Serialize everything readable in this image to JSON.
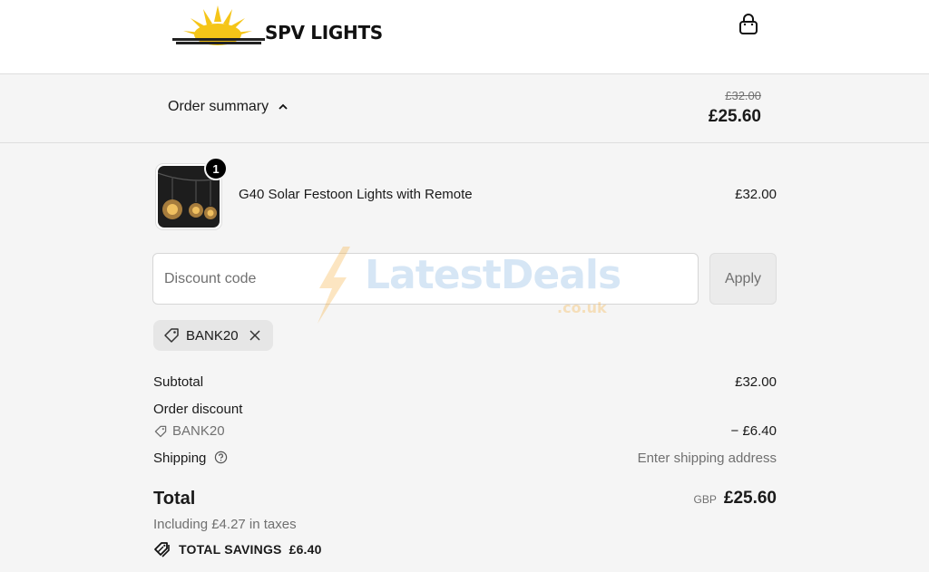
{
  "header": {
    "brand": "SPV LIGHTS",
    "cart_icon": "shopping-bag-icon"
  },
  "summary": {
    "toggle_label": "Order summary",
    "compare_price": "£32.00",
    "total": "£25.60"
  },
  "line_item": {
    "name": "G40 Solar Festoon Lights with Remote",
    "price": "£32.00",
    "quantity": "1"
  },
  "discount": {
    "placeholder": "Discount code",
    "apply_label": "Apply",
    "applied_code": "BANK20"
  },
  "totals": {
    "subtotal_label": "Subtotal",
    "subtotal_value": "£32.00",
    "order_discount_label": "Order discount",
    "discount_code": "BANK20",
    "discount_value": "− £6.40",
    "shipping_label": "Shipping",
    "shipping_value": "Enter shipping address",
    "total_label": "Total",
    "currency": "GBP",
    "total_value": "£25.60",
    "taxes_note": "Including £4.27 in taxes",
    "savings_label": "TOTAL SAVINGS",
    "savings_value": "£6.40"
  },
  "watermark": {
    "text": "LatestDeals",
    "sub": ".co.uk"
  },
  "colors": {
    "background": "#f5f5f5",
    "header_bg": "#ffffff",
    "text": "#1a1a1a",
    "muted": "#707070",
    "logo_sun": "#f5c518"
  }
}
